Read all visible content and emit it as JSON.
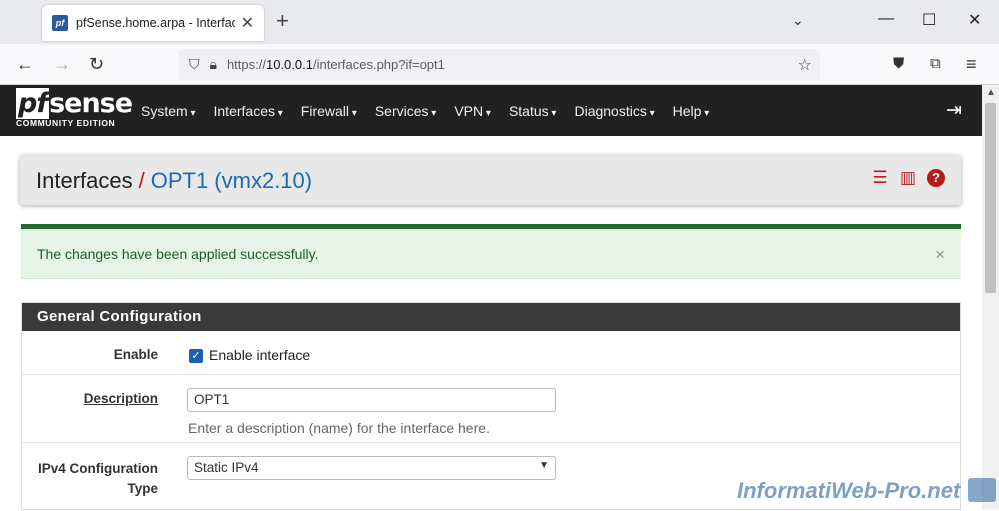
{
  "browser": {
    "tab_title": "pfSense.home.arpa - Interfaces:",
    "tab_close": "✕",
    "new_tab": "+",
    "url_prefix": "https://",
    "url_host": "10.0.0.1",
    "url_path": "/interfaces.php?if=opt1"
  },
  "pfsense": {
    "logo_main_pf": "pf",
    "logo_main_rest": "sense",
    "logo_sub": "COMMUNITY EDITION",
    "menu": [
      "System",
      "Interfaces",
      "Firewall",
      "Services",
      "VPN",
      "Status",
      "Diagnostics",
      "Help"
    ]
  },
  "breadcrumb": {
    "section": "Interfaces",
    "separator": "/",
    "current": "OPT1 (vmx2.10)"
  },
  "alert": {
    "message": "The changes have been applied successfully.",
    "close": "×"
  },
  "panel": {
    "title": "General Configuration",
    "enable_label": "Enable",
    "enable_checkbox_label": "Enable interface",
    "enable_checked": true,
    "description_label": "Description",
    "description_value": "OPT1",
    "description_help": "Enter a description (name) for the interface here.",
    "ipv4_label_1": "IPv4 Configuration",
    "ipv4_label_2": "Type",
    "ipv4_value": "Static IPv4"
  },
  "watermark": "InformatiWeb-Pro.net",
  "colors": {
    "brand_red": "#b71c1c",
    "link_blue": "#1a6bb4",
    "success_green": "#1e6b2b",
    "header_dark": "#212121"
  }
}
